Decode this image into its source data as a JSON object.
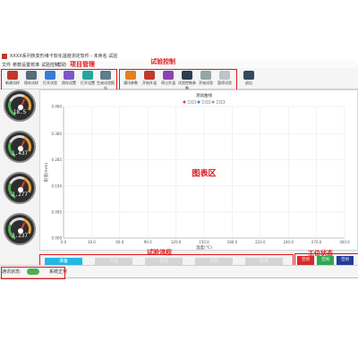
{
  "window": {
    "title": "XXXX系列热变形维卡软化温度测定软件 - 未命名.试验"
  },
  "menu": [
    "文件",
    "参数设置",
    "校准",
    "试验控制",
    "帮助"
  ],
  "annotations": {
    "project": "项目管理",
    "control": "试验控制",
    "chart": "图表区",
    "process": "试验流程",
    "status": "工位状态"
  },
  "toolbar": {
    "project_buttons": [
      "新建试样",
      "保存试样",
      "打开试验",
      "保存设置",
      "打开设置",
      "生成试验报告"
    ],
    "control_buttons": [
      "通讯参数",
      "开始升温",
      "停止升温",
      "试验控制参数",
      "开始试验",
      "暂停试验"
    ],
    "extra_button": "退出"
  },
  "gauges": [
    {
      "value": "18.5"
    },
    {
      "value": "1.437"
    },
    {
      "value": "2.277"
    },
    {
      "value": "3.237"
    }
  ],
  "chart_data": {
    "type": "line",
    "title": "测试曲线",
    "legend": [
      "工位1",
      "工位2",
      "工位3"
    ],
    "legend_colors": [
      "#e03a3a",
      "#3a7be0",
      "#999999"
    ],
    "xlabel": "温度(°C)",
    "ylabel": "形变(mm)",
    "xlim": [
      0,
      300
    ],
    "ylim": [
      0,
      0.48
    ],
    "xticks": [
      "0.0",
      "30.0",
      "60.0",
      "90.0",
      "120.0",
      "150.0",
      "180.0",
      "210.0",
      "240.0",
      "270.0",
      "300.0"
    ],
    "yticks": [
      "0.000",
      "0.095",
      "0.190",
      "0.285",
      "0.380",
      "0.480"
    ],
    "grid": true,
    "series": []
  },
  "process": {
    "steps": [
      "准备",
      "升温",
      "保温",
      "试验",
      "结束"
    ],
    "active_index": 0
  },
  "stations": [
    {
      "label": "空闲",
      "color": "#d42b2b"
    },
    {
      "label": "空闲",
      "color": "#2fa84f"
    },
    {
      "label": "空闲",
      "color": "#1f3c9c"
    }
  ],
  "statusbar": {
    "comm_label": "通讯状态:",
    "system_label": "系统正常"
  }
}
